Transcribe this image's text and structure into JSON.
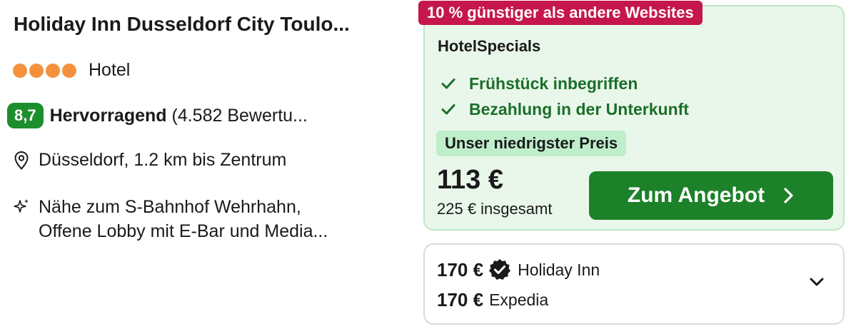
{
  "hotel": {
    "title": "Holiday Inn Dusseldorf City Toulo...",
    "type": "Hotel",
    "stars": 4,
    "score": "8,7",
    "rating_label": "Hervorragend",
    "rating_count": "(4.582 Bewertu...",
    "location": "Düsseldorf, 1.2 km bis Zentrum",
    "features": [
      "Nähe zum S-Bahnhof Wehrhahn,",
      "Offene Lobby mit E-Bar und Media..."
    ]
  },
  "deal": {
    "badge": "10 % günstiger als andere Websites",
    "provider": "HotelSpecials",
    "inclusions": [
      "Frühstück inbegriffen",
      "Bezahlung in der Unterkunft"
    ],
    "lowest_label": "Unser niedrigster Preis",
    "price": "113 €",
    "total": "225 € insgesamt",
    "cta_label": "Zum Angebot"
  },
  "other_offers": [
    {
      "price": "170 €",
      "name": "Holiday Inn",
      "verified": true
    },
    {
      "price": "170 €",
      "name": "Expedia",
      "verified": false
    }
  ],
  "colors": {
    "star": "#f5913e",
    "score_bg": "#1c8f2c",
    "badge_bg": "#c5174b",
    "deal_bg": "#e9f7ea",
    "cta_bg": "#1c8128",
    "check": "#1b6e2a"
  },
  "icons": {
    "location": "map-pin-icon",
    "feature": "sparkle-icon",
    "check": "check-icon",
    "cta_arrow": "chevron-right-icon",
    "verified": "verified-badge-icon",
    "expand": "chevron-down-icon"
  }
}
